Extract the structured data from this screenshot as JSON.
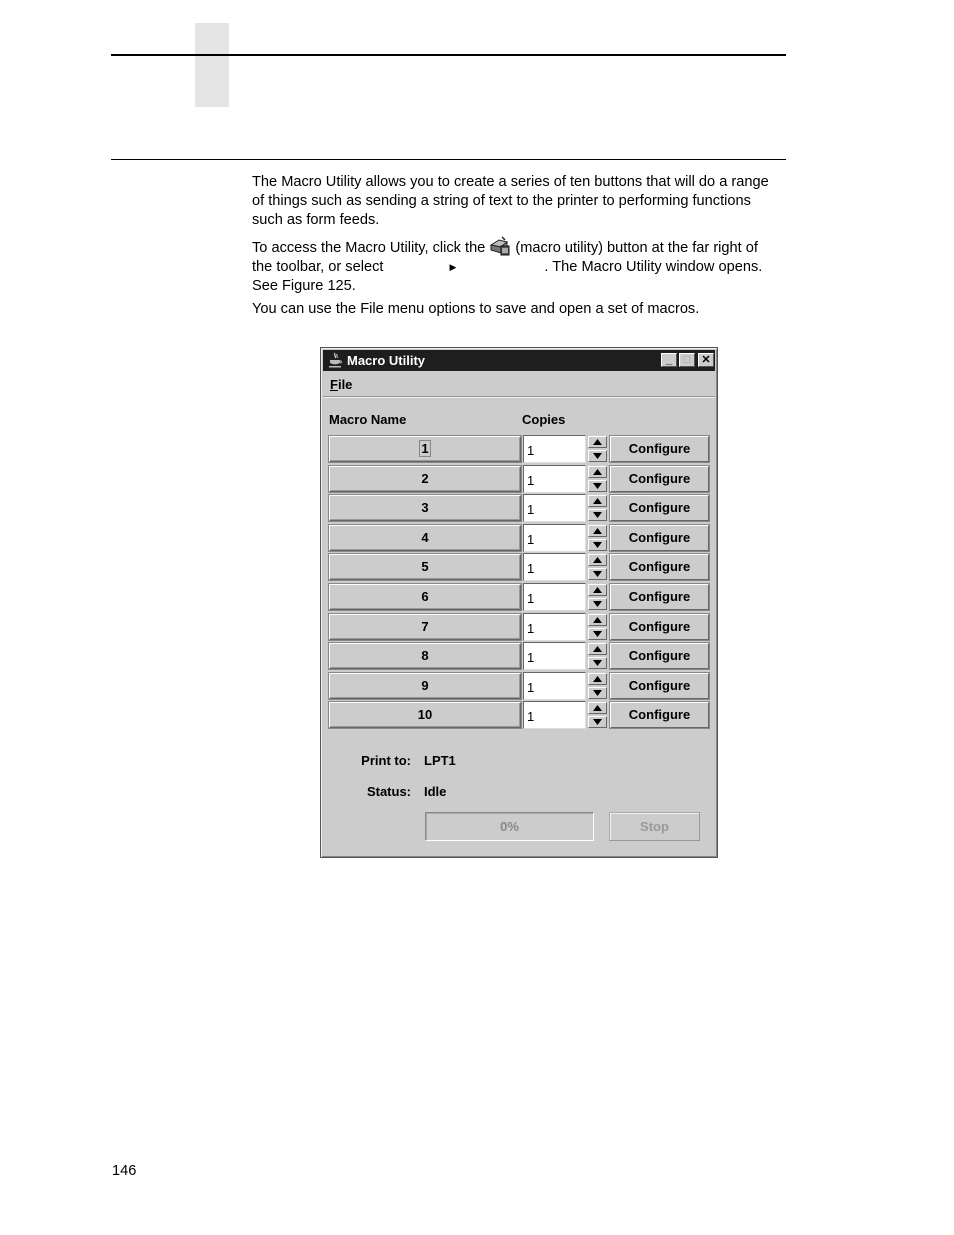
{
  "page": {
    "page_number": "146",
    "paragraphs": {
      "p1": "The Macro Utility allows you to create a series of ten buttons that will do a range of things such as sending a string of text to the printer to performing functions such as form feeds.",
      "p2_before_icon": "To access the Macro Utility, click the ",
      "p2_after_icon": " (macro utility) button at the far right of the toolbar, or select ",
      "p2_arrow": "▶",
      "p2_end": ". The Macro Utility window opens. See Figure 125.",
      "p3": "You can use the File menu options to save and open a set of macros."
    },
    "inline_icon": "macro-utility-icon"
  },
  "window": {
    "title": "Macro Utility",
    "controls": {
      "minimize": "_",
      "maximize": "□",
      "close": "✕"
    },
    "menu": {
      "file_mnemonic": "F",
      "file_rest": "ile"
    },
    "columns": {
      "macro_name": "Macro Name",
      "copies": "Copies"
    },
    "macros": [
      {
        "name": "1",
        "copies": "1",
        "configure": "Configure"
      },
      {
        "name": "2",
        "copies": "1",
        "configure": "Configure"
      },
      {
        "name": "3",
        "copies": "1",
        "configure": "Configure"
      },
      {
        "name": "4",
        "copies": "1",
        "configure": "Configure"
      },
      {
        "name": "5",
        "copies": "1",
        "configure": "Configure"
      },
      {
        "name": "6",
        "copies": "1",
        "configure": "Configure"
      },
      {
        "name": "7",
        "copies": "1",
        "configure": "Configure"
      },
      {
        "name": "8",
        "copies": "1",
        "configure": "Configure"
      },
      {
        "name": "9",
        "copies": "1",
        "configure": "Configure"
      },
      {
        "name": "10",
        "copies": "1",
        "configure": "Configure"
      }
    ],
    "print_to_label": "Print to:",
    "print_to_value": "LPT1",
    "status_label": "Status:",
    "status_value": "Idle",
    "progress_text": "0%",
    "progress_fraction": 0,
    "stop_label": "Stop"
  }
}
